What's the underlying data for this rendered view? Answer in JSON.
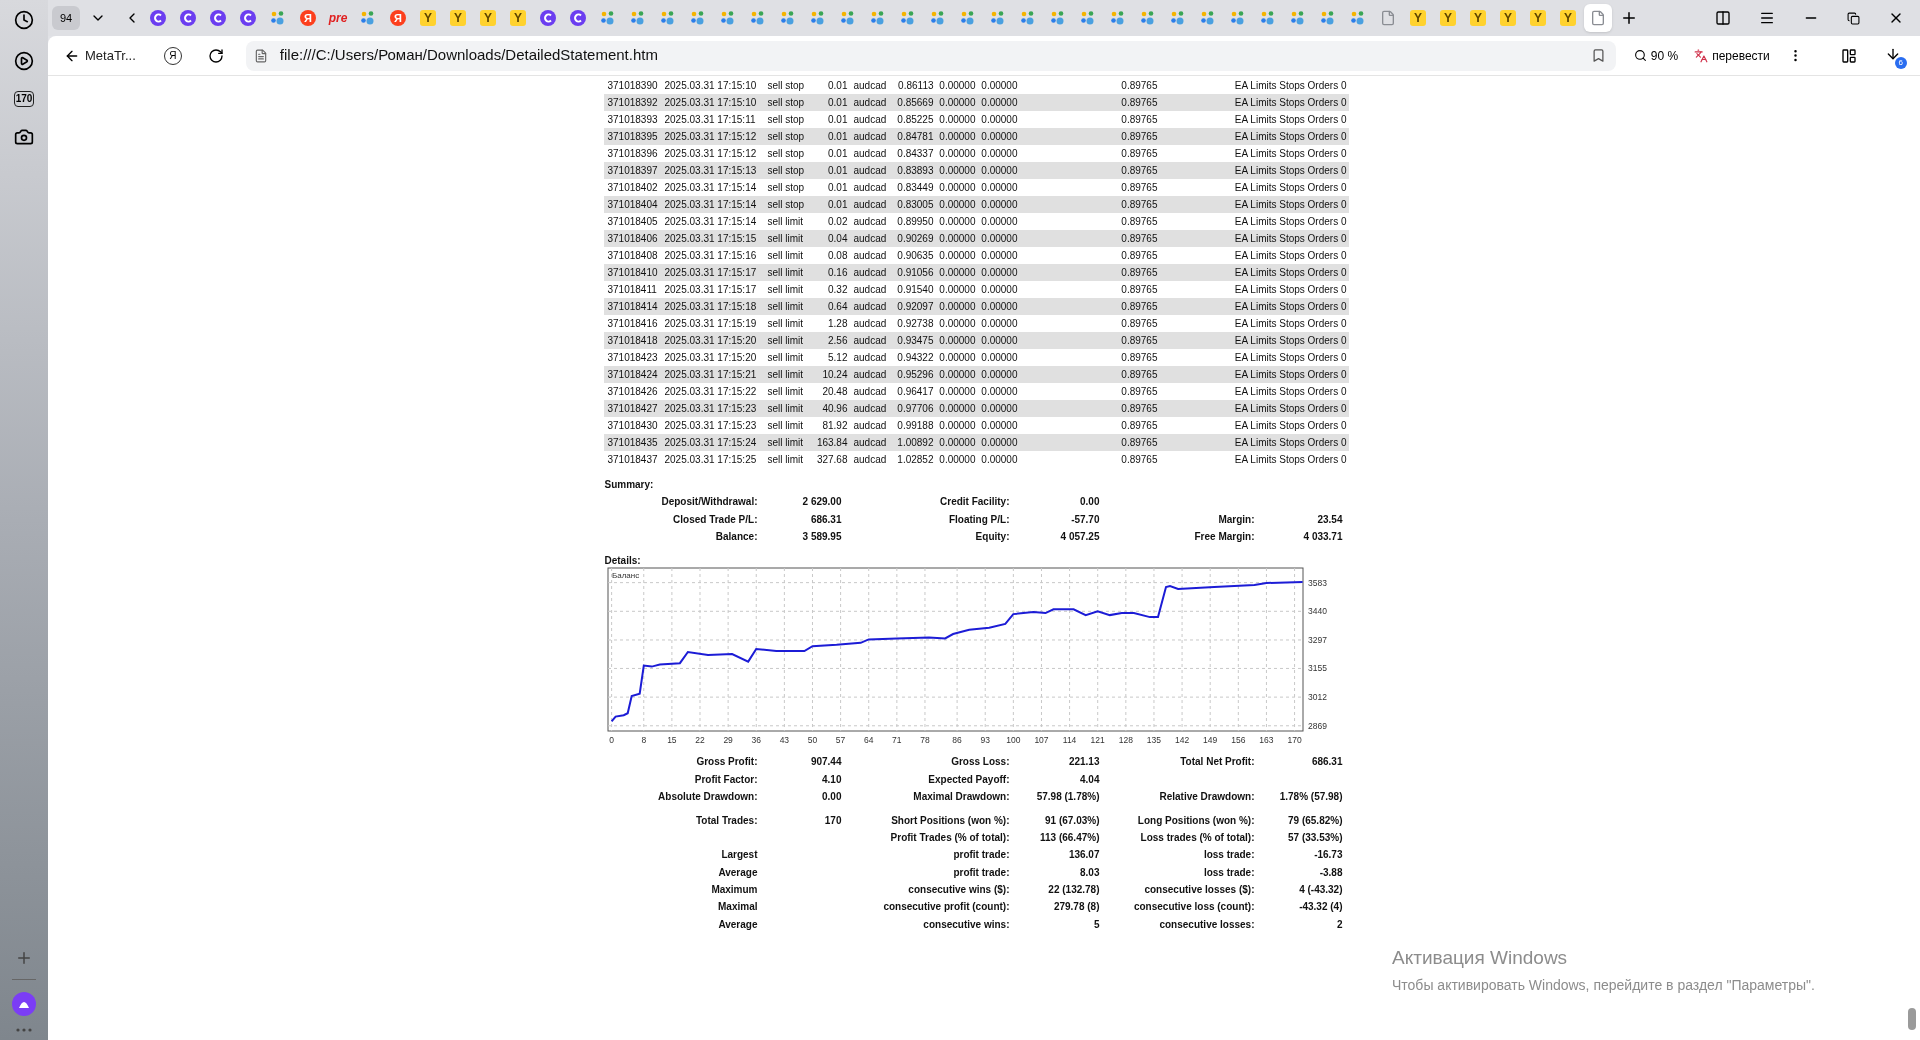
{
  "sidebar": {
    "counter": "170"
  },
  "tab_strip": {
    "counter": "94",
    "tabs": [
      {
        "kind": "swirl",
        "selected": false
      },
      {
        "kind": "swirl",
        "selected": false
      },
      {
        "kind": "swirl",
        "selected": false
      },
      {
        "kind": "swirl",
        "selected": false
      },
      {
        "kind": "paw",
        "selected": false
      },
      {
        "kind": "letter",
        "glyph": "Я",
        "selected": false
      },
      {
        "kind": "word",
        "glyph": "pre",
        "selected": false
      },
      {
        "kind": "paw",
        "selected": false
      },
      {
        "kind": "letter",
        "glyph": "Я",
        "selected": false
      },
      {
        "kind": "tile",
        "glyph": "Y",
        "selected": false
      },
      {
        "kind": "tile",
        "glyph": "Y",
        "selected": false
      },
      {
        "kind": "tile",
        "glyph": "Y",
        "selected": false
      },
      {
        "kind": "tile",
        "glyph": "Y",
        "selected": false
      },
      {
        "kind": "swirl",
        "selected": false
      },
      {
        "kind": "swirl",
        "selected": false
      },
      {
        "kind": "paw",
        "selected": false
      },
      {
        "kind": "paw",
        "selected": false
      },
      {
        "kind": "paw",
        "selected": false
      },
      {
        "kind": "paw",
        "selected": false
      },
      {
        "kind": "paw",
        "selected": false
      },
      {
        "kind": "paw",
        "selected": false
      },
      {
        "kind": "paw",
        "selected": false
      },
      {
        "kind": "paw",
        "selected": false
      },
      {
        "kind": "paw",
        "selected": false
      },
      {
        "kind": "paw",
        "selected": false
      },
      {
        "kind": "paw",
        "selected": false
      },
      {
        "kind": "paw",
        "selected": false
      },
      {
        "kind": "paw",
        "selected": false
      },
      {
        "kind": "paw",
        "selected": false
      },
      {
        "kind": "paw",
        "selected": false
      },
      {
        "kind": "paw",
        "selected": false
      },
      {
        "kind": "paw",
        "selected": false
      },
      {
        "kind": "paw",
        "selected": false
      },
      {
        "kind": "paw",
        "selected": false
      },
      {
        "kind": "paw",
        "selected": false
      },
      {
        "kind": "paw",
        "selected": false
      },
      {
        "kind": "paw",
        "selected": false
      },
      {
        "kind": "paw",
        "selected": false
      },
      {
        "kind": "paw",
        "selected": false
      },
      {
        "kind": "paw",
        "selected": false
      },
      {
        "kind": "paw",
        "selected": false
      },
      {
        "kind": "page",
        "selected": false
      },
      {
        "kind": "tile",
        "glyph": "Y",
        "selected": false
      },
      {
        "kind": "tile",
        "glyph": "Y",
        "selected": false
      },
      {
        "kind": "tile",
        "glyph": "Y",
        "selected": false
      },
      {
        "kind": "tile",
        "glyph": "Y",
        "selected": false
      },
      {
        "kind": "tile",
        "glyph": "Y",
        "selected": false
      },
      {
        "kind": "tile",
        "glyph": "Y",
        "selected": false
      },
      {
        "kind": "page",
        "selected": true
      }
    ]
  },
  "address_bar": {
    "back_label": "MetaTr...",
    "service_glyph": "Я",
    "url": "file:///C:/Users/Роман/Downloads/DetailedStatement.htm",
    "zoom": "90 %",
    "translate": "перевести",
    "downloads_badge": "6"
  },
  "orders_table": {
    "rows": [
      [
        "371018390",
        "2025.03.31 17:15:10",
        "sell stop",
        "0.01",
        "audcad",
        "0.86113",
        "0.00000",
        "0.00000",
        "0.89765",
        "EA Limits Stops Orders 0"
      ],
      [
        "371018392",
        "2025.03.31 17:15:10",
        "sell stop",
        "0.01",
        "audcad",
        "0.85669",
        "0.00000",
        "0.00000",
        "0.89765",
        "EA Limits Stops Orders 0"
      ],
      [
        "371018393",
        "2025.03.31 17:15:11",
        "sell stop",
        "0.01",
        "audcad",
        "0.85225",
        "0.00000",
        "0.00000",
        "0.89765",
        "EA Limits Stops Orders 0"
      ],
      [
        "371018395",
        "2025.03.31 17:15:12",
        "sell stop",
        "0.01",
        "audcad",
        "0.84781",
        "0.00000",
        "0.00000",
        "0.89765",
        "EA Limits Stops Orders 0"
      ],
      [
        "371018396",
        "2025.03.31 17:15:12",
        "sell stop",
        "0.01",
        "audcad",
        "0.84337",
        "0.00000",
        "0.00000",
        "0.89765",
        "EA Limits Stops Orders 0"
      ],
      [
        "371018397",
        "2025.03.31 17:15:13",
        "sell stop",
        "0.01",
        "audcad",
        "0.83893",
        "0.00000",
        "0.00000",
        "0.89765",
        "EA Limits Stops Orders 0"
      ],
      [
        "371018402",
        "2025.03.31 17:15:14",
        "sell stop",
        "0.01",
        "audcad",
        "0.83449",
        "0.00000",
        "0.00000",
        "0.89765",
        "EA Limits Stops Orders 0"
      ],
      [
        "371018404",
        "2025.03.31 17:15:14",
        "sell stop",
        "0.01",
        "audcad",
        "0.83005",
        "0.00000",
        "0.00000",
        "0.89765",
        "EA Limits Stops Orders 0"
      ],
      [
        "371018405",
        "2025.03.31 17:15:14",
        "sell limit",
        "0.02",
        "audcad",
        "0.89950",
        "0.00000",
        "0.00000",
        "0.89765",
        "EA Limits Stops Orders 0"
      ],
      [
        "371018406",
        "2025.03.31 17:15:15",
        "sell limit",
        "0.04",
        "audcad",
        "0.90269",
        "0.00000",
        "0.00000",
        "0.89765",
        "EA Limits Stops Orders 0"
      ],
      [
        "371018408",
        "2025.03.31 17:15:16",
        "sell limit",
        "0.08",
        "audcad",
        "0.90635",
        "0.00000",
        "0.00000",
        "0.89765",
        "EA Limits Stops Orders 0"
      ],
      [
        "371018410",
        "2025.03.31 17:15:17",
        "sell limit",
        "0.16",
        "audcad",
        "0.91056",
        "0.00000",
        "0.00000",
        "0.89765",
        "EA Limits Stops Orders 0"
      ],
      [
        "371018411",
        "2025.03.31 17:15:17",
        "sell limit",
        "0.32",
        "audcad",
        "0.91540",
        "0.00000",
        "0.00000",
        "0.89765",
        "EA Limits Stops Orders 0"
      ],
      [
        "371018414",
        "2025.03.31 17:15:18",
        "sell limit",
        "0.64",
        "audcad",
        "0.92097",
        "0.00000",
        "0.00000",
        "0.89765",
        "EA Limits Stops Orders 0"
      ],
      [
        "371018416",
        "2025.03.31 17:15:19",
        "sell limit",
        "1.28",
        "audcad",
        "0.92738",
        "0.00000",
        "0.00000",
        "0.89765",
        "EA Limits Stops Orders 0"
      ],
      [
        "371018418",
        "2025.03.31 17:15:20",
        "sell limit",
        "2.56",
        "audcad",
        "0.93475",
        "0.00000",
        "0.00000",
        "0.89765",
        "EA Limits Stops Orders 0"
      ],
      [
        "371018423",
        "2025.03.31 17:15:20",
        "sell limit",
        "5.12",
        "audcad",
        "0.94322",
        "0.00000",
        "0.00000",
        "0.89765",
        "EA Limits Stops Orders 0"
      ],
      [
        "371018424",
        "2025.03.31 17:15:21",
        "sell limit",
        "10.24",
        "audcad",
        "0.95296",
        "0.00000",
        "0.00000",
        "0.89765",
        "EA Limits Stops Orders 0"
      ],
      [
        "371018426",
        "2025.03.31 17:15:22",
        "sell limit",
        "20.48",
        "audcad",
        "0.96417",
        "0.00000",
        "0.00000",
        "0.89765",
        "EA Limits Stops Orders 0"
      ],
      [
        "371018427",
        "2025.03.31 17:15:23",
        "sell limit",
        "40.96",
        "audcad",
        "0.97706",
        "0.00000",
        "0.00000",
        "0.89765",
        "EA Limits Stops Orders 0"
      ],
      [
        "371018430",
        "2025.03.31 17:15:23",
        "sell limit",
        "81.92",
        "audcad",
        "0.99188",
        "0.00000",
        "0.00000",
        "0.89765",
        "EA Limits Stops Orders 0"
      ],
      [
        "371018435",
        "2025.03.31 17:15:24",
        "sell limit",
        "163.84",
        "audcad",
        "1.00892",
        "0.00000",
        "0.00000",
        "0.89765",
        "EA Limits Stops Orders 0"
      ],
      [
        "371018437",
        "2025.03.31 17:15:25",
        "sell limit",
        "327.68",
        "audcad",
        "1.02852",
        "0.00000",
        "0.00000",
        "0.89765",
        "EA Limits Stops Orders 0"
      ]
    ]
  },
  "summary": {
    "title": "Summary:",
    "rows": [
      {
        "left": {
          "label": "Deposit/Withdrawal:",
          "value": "2 629.00"
        },
        "middle": {
          "label": "Credit Facility:",
          "value": "0.00"
        }
      },
      {
        "left": {
          "label": "Closed Trade P/L:",
          "value": "686.31"
        },
        "middle": {
          "label": "Floating P/L:",
          "value": "-57.70"
        },
        "right": {
          "label": "Margin:",
          "value": "23.54"
        }
      },
      {
        "left": {
          "label": "Balance:",
          "value": "3 589.95"
        },
        "middle": {
          "label": "Equity:",
          "value": "4 057.25"
        },
        "right": {
          "label": "Free Margin:",
          "value": "4 033.71"
        }
      }
    ]
  },
  "details": {
    "title": "Details:",
    "chart_data": {
      "type": "line",
      "title": "Баланс",
      "grid": true,
      "xlim": [
        -0.9,
        172.1
      ],
      "ylim": [
        2843,
        3656
      ],
      "xticks": [
        0,
        8,
        15,
        22,
        29,
        36,
        43,
        50,
        57,
        64,
        71,
        78,
        86,
        93,
        100,
        107,
        114,
        121,
        128,
        135,
        142,
        149,
        156,
        163,
        170
      ],
      "yticks": [
        2869,
        3012,
        3155,
        3297,
        3440,
        3583
      ],
      "x": [
        0,
        1,
        3,
        4,
        5,
        7,
        8,
        10,
        12,
        17,
        19,
        24,
        30,
        34,
        36,
        41,
        48,
        50,
        56,
        62,
        64,
        71,
        79,
        83,
        85,
        89,
        94,
        98,
        100,
        105,
        108,
        110,
        115,
        118,
        121,
        124,
        127,
        130,
        134,
        136,
        138,
        139,
        141,
        150,
        160,
        163,
        172
      ],
      "series": [
        {
          "color": "#1c1cd6",
          "values": [
            2891,
            2915,
            2922,
            2932,
            3017,
            3029,
            3169,
            3164,
            3174,
            3181,
            3237,
            3222,
            3227,
            3189,
            3252,
            3242,
            3242,
            3266,
            3273,
            3283,
            3300,
            3305,
            3310,
            3305,
            3327,
            3348,
            3358,
            3377,
            3426,
            3436,
            3431,
            3450,
            3450,
            3421,
            3440,
            3421,
            3431,
            3431,
            3411,
            3411,
            3561,
            3566,
            3552,
            3561,
            3571,
            3581,
            3586
          ]
        }
      ]
    }
  },
  "stats": [
    [
      {
        "left": {
          "label": "Gross Profit:",
          "value": "907.44"
        },
        "middle": {
          "label": "Gross Loss:",
          "value": "221.13"
        },
        "right": {
          "label": "Total Net Profit:",
          "value": "686.31"
        }
      },
      {
        "left": {
          "label": "Profit Factor:",
          "value": "4.10"
        },
        "middle": {
          "label": "Expected Payoff:",
          "value": "4.04"
        }
      },
      {
        "left": {
          "label": "Absolute Drawdown:",
          "value": "0.00"
        },
        "middle": {
          "label": "Maximal Drawdown:",
          "value": "57.98 (1.78%)"
        },
        "right": {
          "label": "Relative Drawdown:",
          "value": "1.78% (57.98)"
        }
      }
    ],
    [
      {
        "left": {
          "label": "Total Trades:",
          "value": "170"
        },
        "middle": {
          "label": "Short Positions (won %):",
          "value": "91 (67.03%)"
        },
        "right": {
          "label": "Long Positions (won %):",
          "value": "79 (65.82%)"
        }
      },
      {
        "middle": {
          "label": "Profit Trades (% of total):",
          "value": "113 (66.47%)"
        },
        "right": {
          "label": "Loss trades (% of total):",
          "value": "57 (33.53%)"
        }
      },
      {
        "left": {
          "label": "Largest"
        },
        "middle": {
          "label": "profit trade:",
          "value": "136.07"
        },
        "right": {
          "label": "loss trade:",
          "value": "-16.73"
        }
      },
      {
        "left": {
          "label": "Average"
        },
        "middle": {
          "label": "profit trade:",
          "value": "8.03"
        },
        "right": {
          "label": "loss trade:",
          "value": "-3.88"
        }
      },
      {
        "left": {
          "label": "Maximum"
        },
        "middle": {
          "label": "consecutive wins ($):",
          "value": "22 (132.78)"
        },
        "right": {
          "label": "consecutive losses ($):",
          "value": "4 (-43.32)"
        }
      },
      {
        "left": {
          "label": "Maximal"
        },
        "middle": {
          "label": "consecutive profit (count):",
          "value": "279.78 (8)"
        },
        "right": {
          "label": "consecutive loss (count):",
          "value": "-43.32 (4)"
        }
      },
      {
        "left": {
          "label": "Average"
        },
        "middle": {
          "label": "consecutive wins:",
          "value": "5"
        },
        "right": {
          "label": "consecutive losses:",
          "value": "2"
        }
      }
    ]
  ],
  "activation_notice": {
    "title": "Активация Windows",
    "text": "Чтобы активировать Windows, перейдите в раздел \"Параметры\"."
  }
}
